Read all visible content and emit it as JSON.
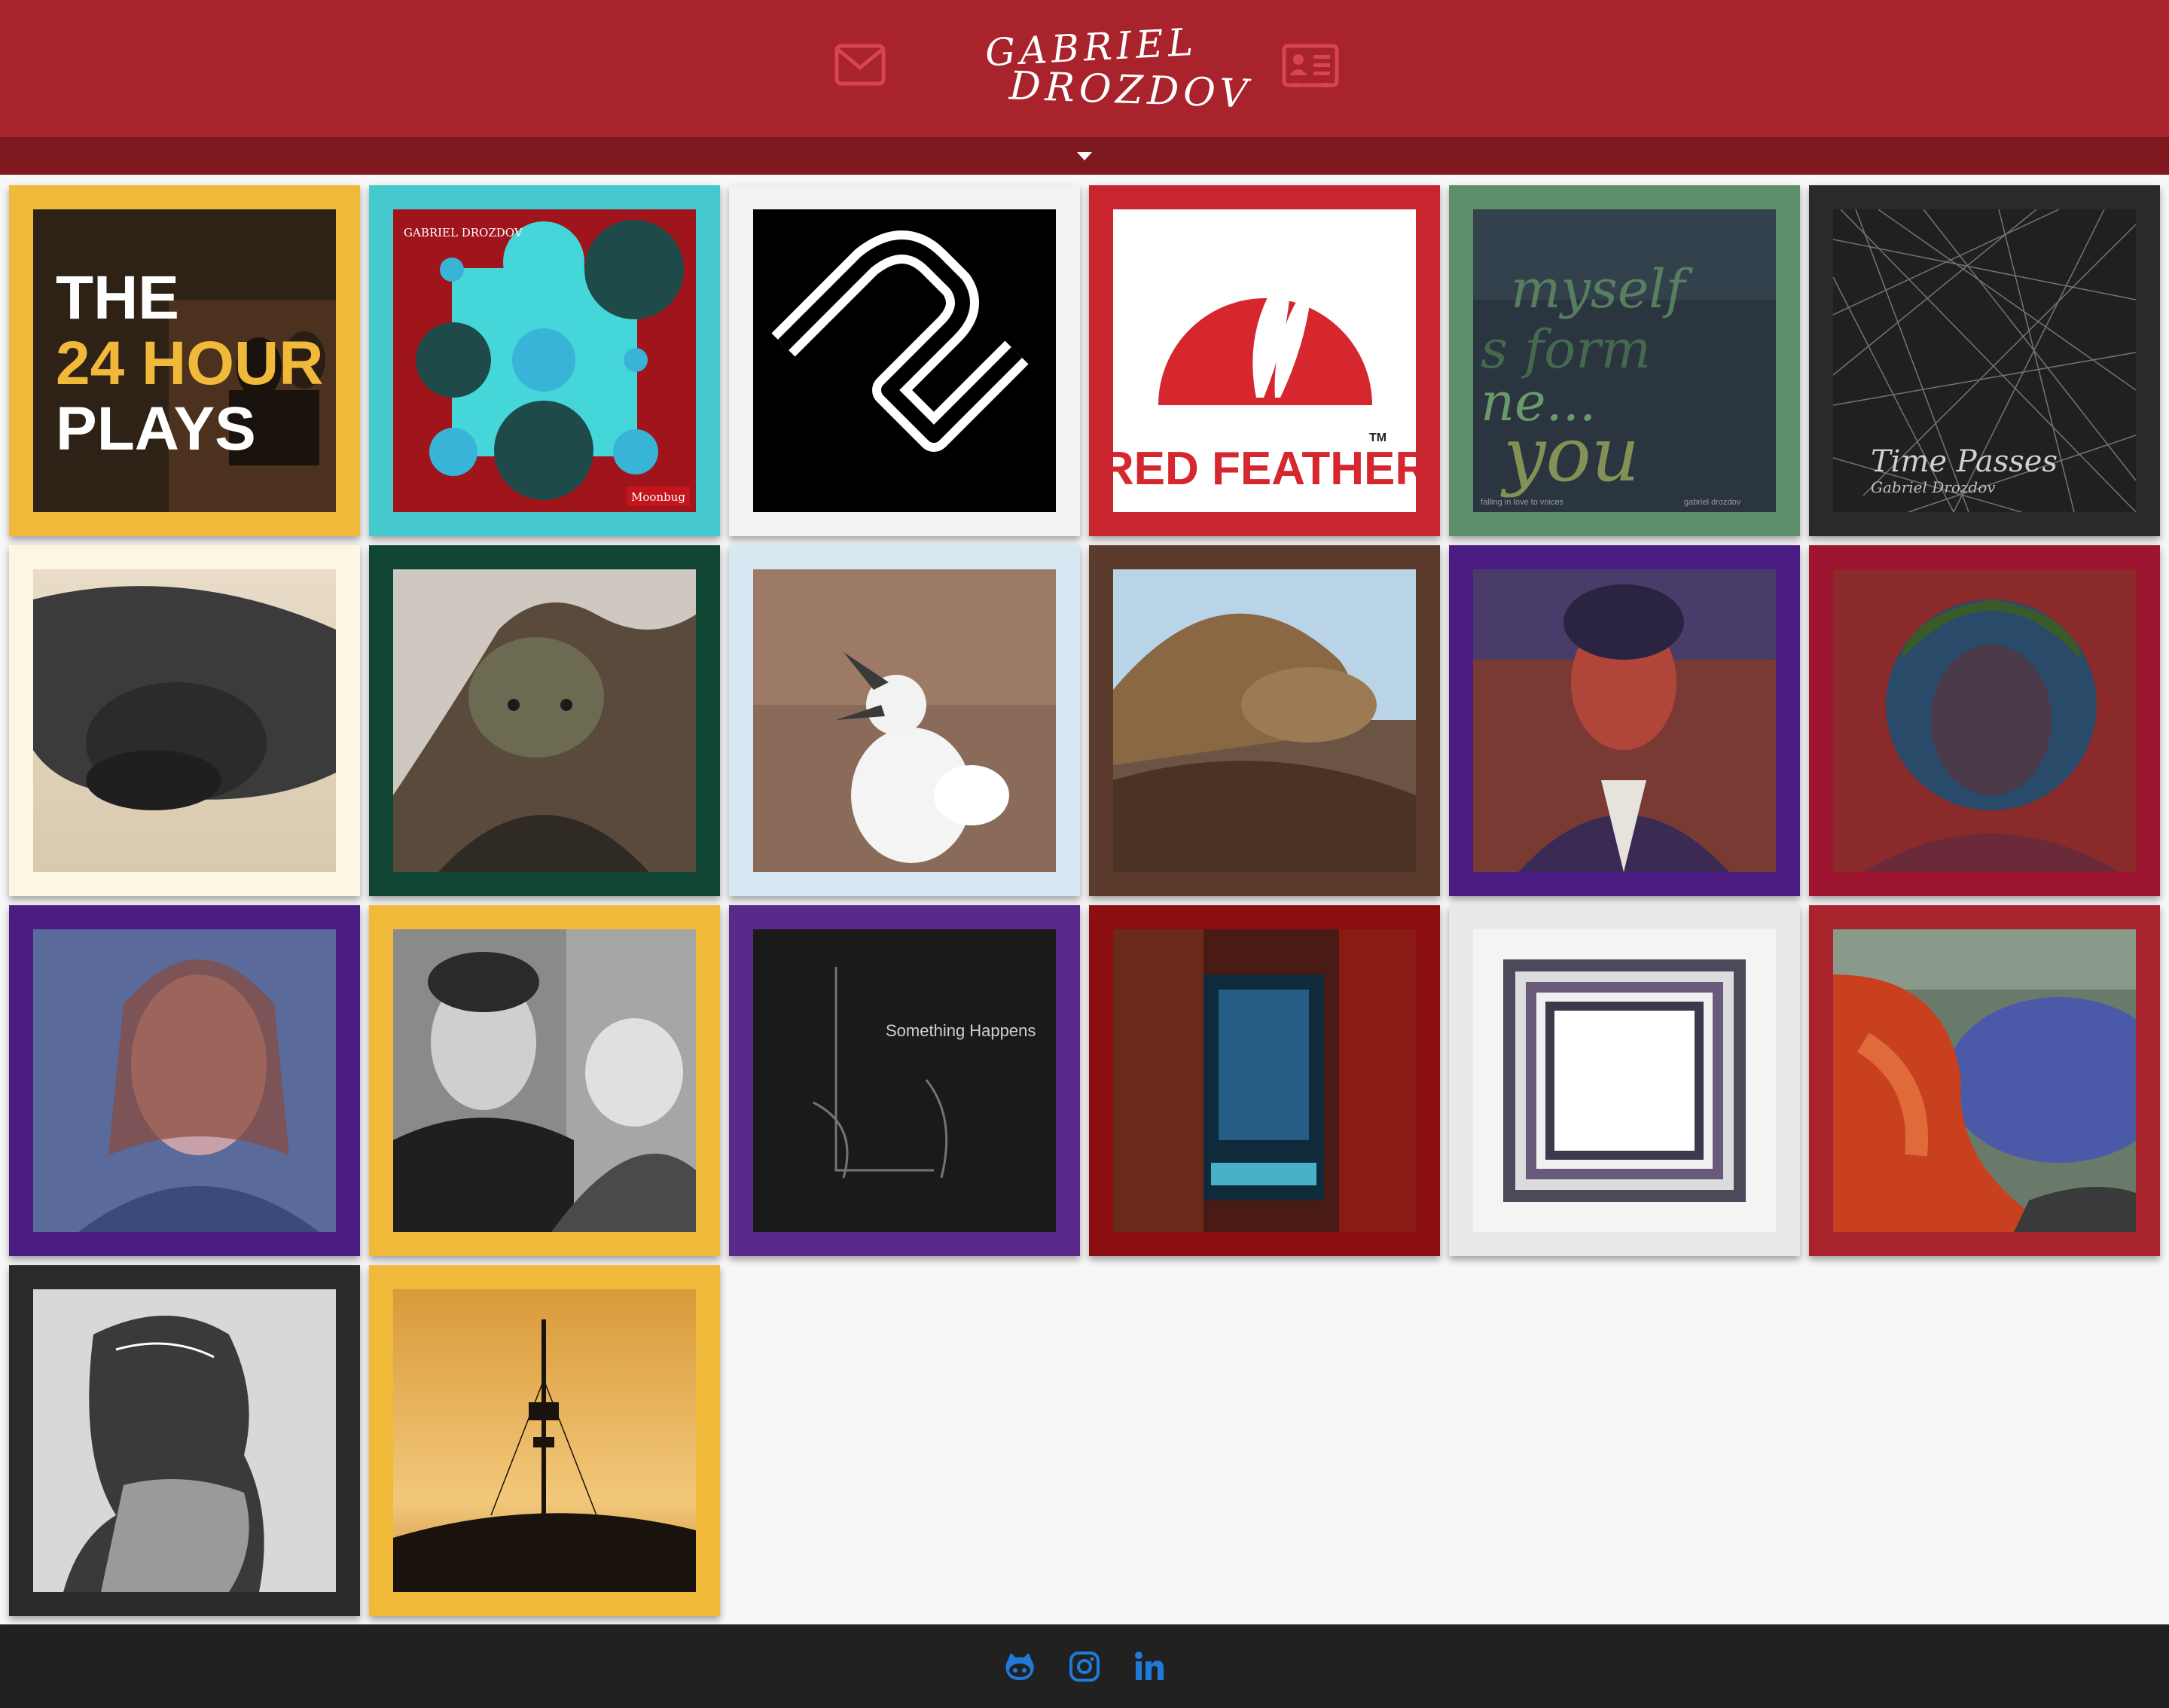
{
  "header": {
    "logo_line1": "GABRIEL",
    "logo_line2": "DROZDOV",
    "mail_icon": "envelope-icon",
    "contact_icon": "contact-card-icon",
    "drawer_icon": "caret-down-icon"
  },
  "colors": {
    "header": "#a8232c",
    "drawer": "#7f1920",
    "icons_header": "#d9454f",
    "background": "#f7f7f7",
    "footer": "#212121",
    "social": "#1f7ad8"
  },
  "gallery": {
    "items": [
      {
        "frame": "#f0b93a",
        "art": {
          "title_line1": "THE",
          "title_line2": "24 HOUR",
          "title_line3": "PLAYS"
        }
      },
      {
        "frame": "#45c9cf",
        "art": {
          "label_top": "GABRIEL DROZDOV",
          "label_bottom": "Moonbug"
        }
      },
      {
        "frame": "#f2f2f2",
        "art": {
          "icon": "letter-mark-logo"
        }
      },
      {
        "frame": "#c9252f",
        "art": {
          "brand": "RED FEATHER",
          "tm": "TM"
        }
      },
      {
        "frame": "#5d8f6c",
        "art": {
          "caption_left": "falling in love to voices",
          "caption_right": "gabriel drozdov"
        }
      },
      {
        "frame": "#2a2a2a",
        "art": {
          "title": "Time Passes",
          "subtitle": "Gabriel Drozdov"
        }
      },
      {
        "frame": "#fdf6e3",
        "art": {
          "subject": "sea-lion-pup-photo"
        }
      },
      {
        "frame": "#0f4532",
        "art": {
          "subject": "marine-iguana-photo"
        }
      },
      {
        "frame": "#d8e8f2",
        "art": {
          "subject": "booby-chick-photo"
        }
      },
      {
        "frame": "#5a3b2c",
        "art": {
          "subject": "sea-lion-photo"
        }
      },
      {
        "frame": "#4b1d83",
        "art": {
          "subject": "portrait-painting"
        }
      },
      {
        "frame": "#9d1530",
        "art": {
          "subject": "portrait-painting"
        }
      },
      {
        "frame": "#4b1d83",
        "art": {
          "subject": "woman-portrait-painting"
        }
      },
      {
        "frame": "#f0b93a",
        "art": {
          "subject": "father-and-child-photo"
        }
      },
      {
        "frame": "#5a2a8a",
        "art": {
          "title": "Something Happens"
        }
      },
      {
        "frame": "#8c0e10",
        "art": {
          "subject": "abstract-blue-painting"
        }
      },
      {
        "frame": "#e9e9e9",
        "art": {
          "subject": "nested-squares-art"
        }
      },
      {
        "frame": "#a8232c",
        "art": {
          "subject": "coastline-painting"
        }
      },
      {
        "frame": "#2a2a2a",
        "art": {
          "subject": "crumpled-head-drawing"
        }
      },
      {
        "frame": "#f0b93a",
        "art": {
          "subject": "tower-sunset-photo"
        }
      }
    ]
  },
  "footer": {
    "github_icon": "github-icon",
    "instagram_icon": "instagram-icon",
    "linkedin_icon": "linkedin-icon"
  }
}
